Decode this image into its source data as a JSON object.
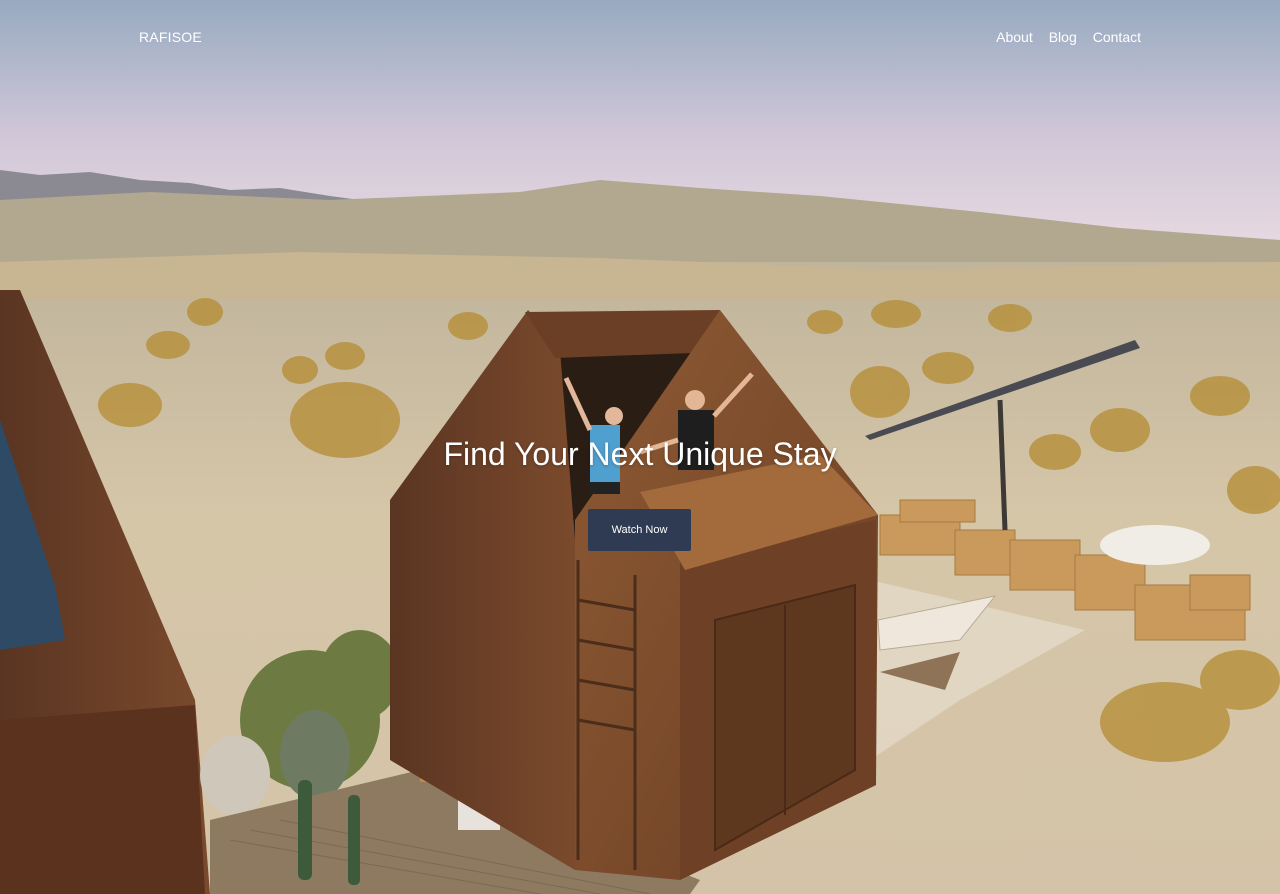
{
  "brand": {
    "name": "RAFISOE"
  },
  "nav": {
    "links": [
      {
        "label": "About"
      },
      {
        "label": "Blog"
      },
      {
        "label": "Contact"
      }
    ]
  },
  "hero": {
    "headline": "Find Your Next Unique Stay",
    "cta_label": "Watch Now",
    "image": "desert-cabin-photo"
  },
  "colors": {
    "cta_background": "#2f3b52",
    "text": "#ffffff"
  }
}
